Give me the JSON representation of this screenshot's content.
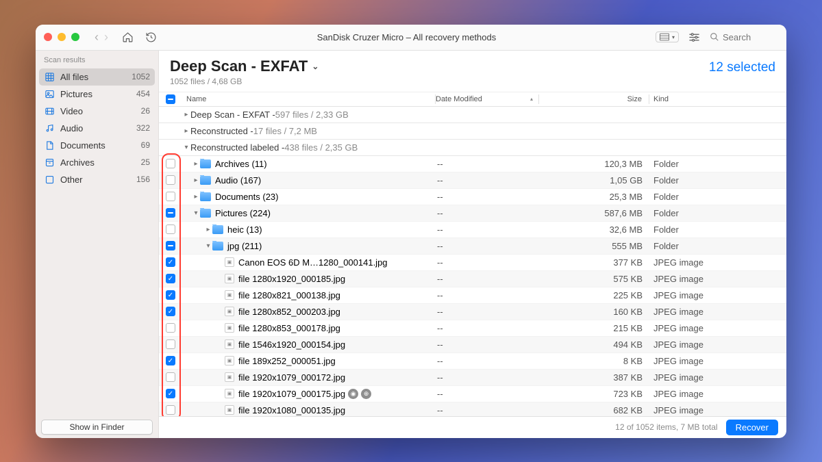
{
  "window_title": "SanDisk Cruzer Micro – All recovery methods",
  "search_placeholder": "Search",
  "sidebar": {
    "header": "Scan results",
    "items": [
      {
        "label": "All files",
        "count": "1052",
        "icon": "grid",
        "selected": true
      },
      {
        "label": "Pictures",
        "count": "454",
        "icon": "picture"
      },
      {
        "label": "Video",
        "count": "26",
        "icon": "video"
      },
      {
        "label": "Audio",
        "count": "322",
        "icon": "audio"
      },
      {
        "label": "Documents",
        "count": "69",
        "icon": "document"
      },
      {
        "label": "Archives",
        "count": "25",
        "icon": "archive"
      },
      {
        "label": "Other",
        "count": "156",
        "icon": "other"
      }
    ],
    "footer_button": "Show in Finder"
  },
  "main_header": {
    "title": "Deep Scan - EXFAT",
    "subtitle": "1052 files / 4,68 GB",
    "selected_text": "12 selected"
  },
  "columns": {
    "check_master_state": "partial",
    "name": "Name",
    "date": "Date Modified",
    "size": "Size",
    "kind": "Kind"
  },
  "groups": [
    {
      "disclosure": "closed",
      "label": "Deep Scan - EXFAT -",
      "meta": " 597 files / 2,33 GB"
    },
    {
      "disclosure": "closed",
      "label": "Reconstructed -",
      "meta": " 17 files / 7,2 MB"
    },
    {
      "disclosure": "open",
      "label": "Reconstructed labeled -",
      "meta": " 438 files / 2,35 GB"
    }
  ],
  "rows": [
    {
      "indent": 0,
      "check": "empty",
      "disclosure": "closed",
      "type": "folder",
      "name": "Archives (11)",
      "date": "--",
      "size": "120,3 MB",
      "kind": "Folder",
      "stripe": false
    },
    {
      "indent": 0,
      "check": "empty",
      "disclosure": "closed",
      "type": "folder",
      "name": "Audio (167)",
      "date": "--",
      "size": "1,05 GB",
      "kind": "Folder",
      "stripe": true
    },
    {
      "indent": 0,
      "check": "empty",
      "disclosure": "closed",
      "type": "folder",
      "name": "Documents (23)",
      "date": "--",
      "size": "25,3 MB",
      "kind": "Folder",
      "stripe": false
    },
    {
      "indent": 0,
      "check": "partial",
      "disclosure": "open",
      "type": "folder",
      "name": "Pictures (224)",
      "date": "--",
      "size": "587,6 MB",
      "kind": "Folder",
      "stripe": true
    },
    {
      "indent": 1,
      "check": "empty",
      "disclosure": "closed",
      "type": "folder",
      "name": "heic (13)",
      "date": "--",
      "size": "32,6 MB",
      "kind": "Folder",
      "stripe": false
    },
    {
      "indent": 1,
      "check": "partial",
      "disclosure": "open",
      "type": "folder",
      "name": "jpg (211)",
      "date": "--",
      "size": "555 MB",
      "kind": "Folder",
      "stripe": true
    },
    {
      "indent": 2,
      "check": "checked",
      "disclosure": "",
      "type": "file",
      "name": "Canon EOS 6D M…1280_000141.jpg",
      "date": "--",
      "size": "377 KB",
      "kind": "JPEG image",
      "stripe": false
    },
    {
      "indent": 2,
      "check": "checked",
      "disclosure": "",
      "type": "file",
      "name": "file 1280x1920_000185.jpg",
      "date": "--",
      "size": "575 KB",
      "kind": "JPEG image",
      "stripe": true
    },
    {
      "indent": 2,
      "check": "checked",
      "disclosure": "",
      "type": "file",
      "name": "file 1280x821_000138.jpg",
      "date": "--",
      "size": "225 KB",
      "kind": "JPEG image",
      "stripe": false
    },
    {
      "indent": 2,
      "check": "checked",
      "disclosure": "",
      "type": "file",
      "name": "file 1280x852_000203.jpg",
      "date": "--",
      "size": "160 KB",
      "kind": "JPEG image",
      "stripe": true
    },
    {
      "indent": 2,
      "check": "empty",
      "disclosure": "",
      "type": "file",
      "name": "file 1280x853_000178.jpg",
      "date": "--",
      "size": "215 KB",
      "kind": "JPEG image",
      "stripe": false
    },
    {
      "indent": 2,
      "check": "empty",
      "disclosure": "",
      "type": "file",
      "name": "file 1546x1920_000154.jpg",
      "date": "--",
      "size": "494 KB",
      "kind": "JPEG image",
      "stripe": true
    },
    {
      "indent": 2,
      "check": "checked",
      "disclosure": "",
      "type": "file",
      "name": "file 189x252_000051.jpg",
      "date": "--",
      "size": "8 KB",
      "kind": "JPEG image",
      "stripe": false
    },
    {
      "indent": 2,
      "check": "empty",
      "disclosure": "",
      "type": "file",
      "name": "file 1920x1079_000172.jpg",
      "date": "--",
      "size": "387 KB",
      "kind": "JPEG image",
      "stripe": true
    },
    {
      "indent": 2,
      "check": "checked",
      "disclosure": "",
      "type": "file",
      "name": "file 1920x1079_000175.jpg",
      "date": "--",
      "size": "723 KB",
      "kind": "JPEG image",
      "stripe": false,
      "badges": true
    },
    {
      "indent": 2,
      "check": "empty",
      "disclosure": "",
      "type": "file",
      "name": "file 1920x1080_000135.jpg",
      "date": "--",
      "size": "682 KB",
      "kind": "JPEG image",
      "stripe": true
    }
  ],
  "footer": {
    "summary": "12 of 1052 items, 7 MB total",
    "recover": "Recover"
  }
}
